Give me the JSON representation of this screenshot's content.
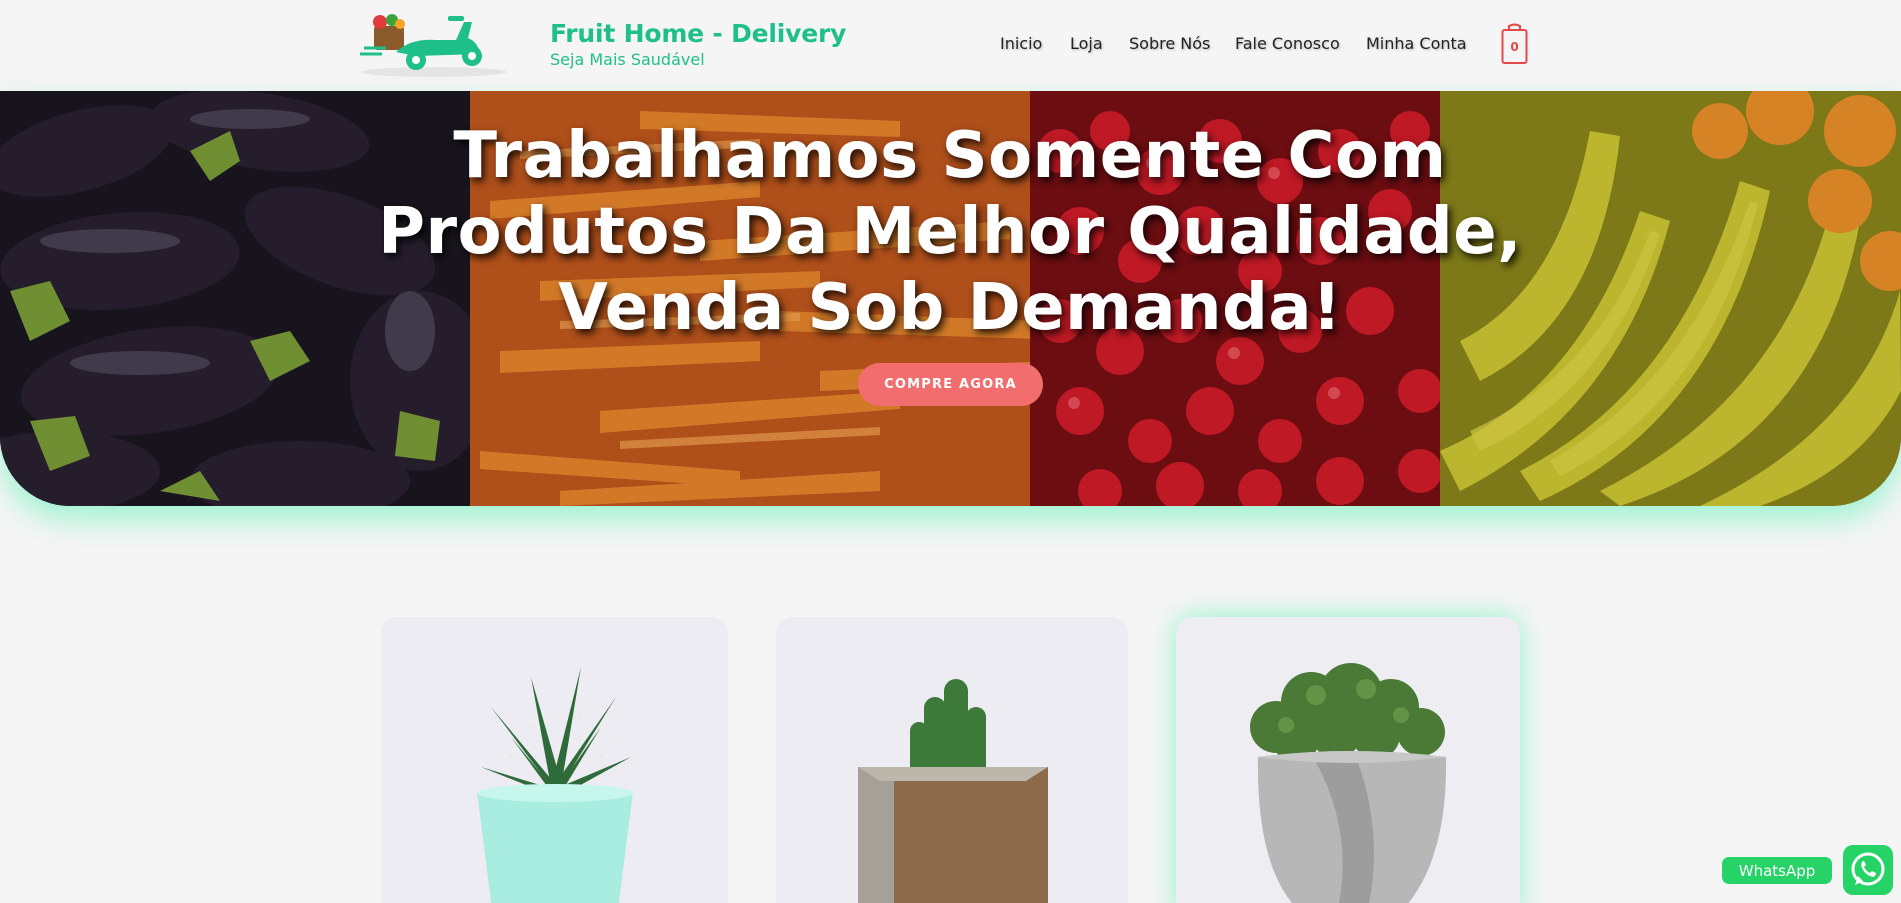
{
  "header": {
    "brand_title": "Fruit Home - Delivery",
    "brand_tagline": "Seja Mais Saudável",
    "nav": [
      {
        "label": "Inicio"
      },
      {
        "label": "Loja"
      },
      {
        "label": "Sobre Nós"
      },
      {
        "label": "Fale Conosco"
      },
      {
        "label": "Minha Conta"
      }
    ],
    "cart_count": "0"
  },
  "hero": {
    "title_line1": "Trabalhamos Somente Com",
    "title_line2": "Produtos Da Melhor Qualidade,",
    "title_line3": "Venda Sob Demanda!",
    "cta_label": "COMPRE AGORA"
  },
  "products": [
    {
      "icon": "succulent-plant-image"
    },
    {
      "icon": "cactus-plant-image"
    },
    {
      "icon": "moss-plant-image"
    }
  ],
  "whatsapp": {
    "label": "WhatsApp",
    "icon": "whatsapp-icon"
  },
  "colors": {
    "brand_green": "#1fbf8a",
    "cta_red": "#f26d6d",
    "whatsapp_green": "#25d366",
    "hero_glow": "#3cf0aa"
  }
}
